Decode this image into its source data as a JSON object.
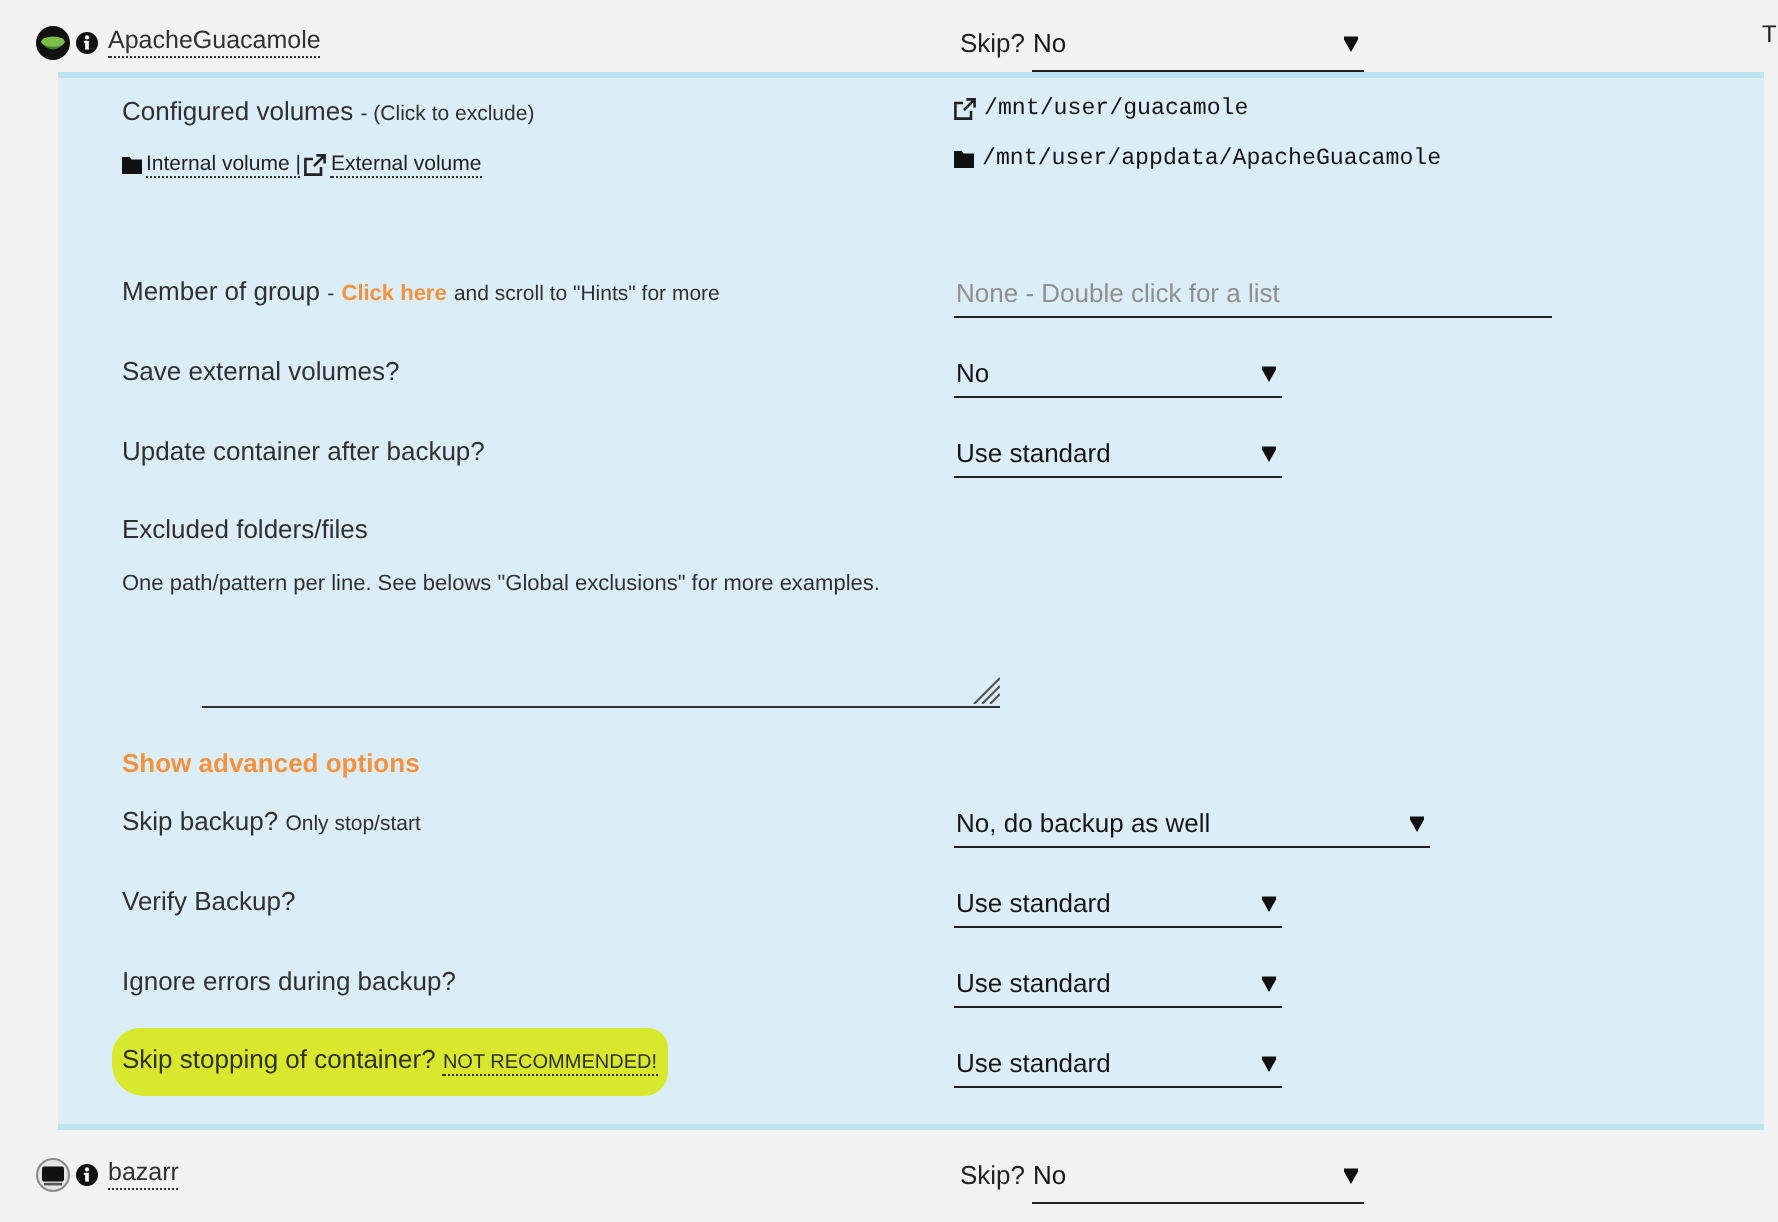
{
  "containers": [
    {
      "kind": "bowl",
      "name": "ApacheGuacamole",
      "skip": {
        "label": "Skip?",
        "value": "No"
      },
      "settings": {
        "volumes": {
          "label": "Configured volumes",
          "note": "- (Click to exclude)",
          "legend": [
            {
              "kind": "folder",
              "text": "Internal volume |"
            },
            {
              "kind": "external",
              "text": "External volume"
            }
          ],
          "paths": [
            {
              "kind": "external",
              "text": "/mnt/user/guacamole"
            },
            {
              "kind": "folder",
              "text": "/mnt/user/appdata/ApacheGuacamole"
            }
          ]
        },
        "rows": [
          {
            "kind": "input",
            "label": "Member of group",
            "note": "-",
            "link": "Click here",
            "note_after": "and scroll to \"Hints\" for more",
            "placeholder": "None - Double click for a list",
            "highlighted": false
          },
          {
            "kind": "select",
            "label": "Save external volumes?",
            "value": "No",
            "highlighted": false
          },
          {
            "kind": "select",
            "label": "Update container after backup?",
            "value": "Use standard",
            "highlighted": false
          },
          {
            "kind": "textarea",
            "label": "Excluded folders/files",
            "help": "One path/pattern per line. See belows \"Global exclusions\" for more examples.",
            "highlighted": false
          },
          {
            "kind": "link",
            "label": "Show advanced options",
            "highlighted": false
          },
          {
            "kind": "select",
            "label": "Skip backup?",
            "note": "Only stop/start",
            "value": "No, do backup as well",
            "highlighted": false
          },
          {
            "kind": "select",
            "label": "Verify Backup?",
            "value": "Use standard",
            "highlighted": false
          },
          {
            "kind": "select",
            "label": "Ignore errors during backup?",
            "value": "Use standard",
            "highlighted": false
          },
          {
            "kind": "select",
            "label": "Skip stopping of container?",
            "warning": "NOT RECOMMENDED!",
            "value": "Use standard",
            "highlighted": true
          }
        ]
      }
    },
    {
      "kind": "screen",
      "name": "bazarr",
      "skip": {
        "label": "Skip?",
        "value": "No"
      }
    }
  ],
  "edge_text": "T"
}
